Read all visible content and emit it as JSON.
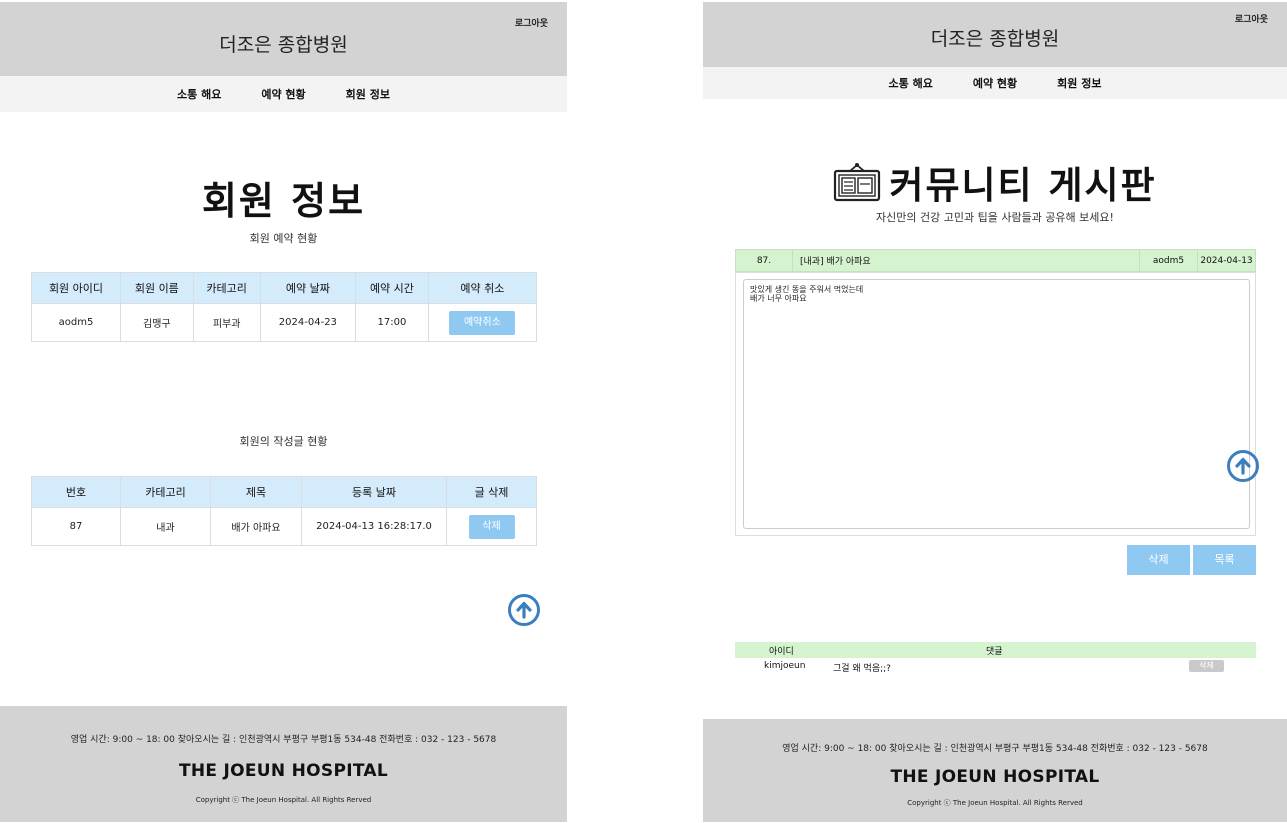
{
  "left": {
    "site_title": "더조은 종합병원",
    "logout": "로그아웃",
    "nav": [
      "소통 해요",
      "예약 현황",
      "회원 정보"
    ],
    "page_title": "회원 정보",
    "reservation_subtitle": "회원 예약 현황",
    "reservation_table": {
      "headers": [
        "회원 아이디",
        "회원 이름",
        "카테고리",
        "예약 날짜",
        "예약 시간",
        "예약 취소"
      ],
      "row": {
        "id": "aodm5",
        "name": "김맹구",
        "category": "피부과",
        "date": "2024-04-23",
        "time": "17:00",
        "cancel": "예약취소"
      }
    },
    "posts_subtitle": "회원의 작성글 현황",
    "posts_table": {
      "headers": [
        "번호",
        "카테고리",
        "제목",
        "등록 날짜",
        "글 삭제"
      ],
      "row": {
        "no": "87",
        "category": "내과",
        "title": "배가 아파요",
        "date": "2024-04-13 16:28:17.0",
        "delete": "삭제"
      }
    },
    "footer": {
      "info": "영업 시간: 9:00 ~ 18: 00     찾아오시는 길 : 인천광역시 부평구 부평1동 534-48     전화번호 : 032 - 123 - 5678",
      "brand": "THE JOEUN HOSPITAL",
      "copyright": "Copyright ⓒ The Joeun Hospital. All Rights Rerved"
    }
  },
  "right": {
    "site_title": "더조은 종합병원",
    "logout": "로그아웃",
    "nav": [
      "소통 해요",
      "예약 현황",
      "회원 정보"
    ],
    "page_title": "커뮤니티 게시판",
    "subtitle": "자신만의 건강 고민과 팁을 사람들과 공유해 보세요!",
    "post": {
      "no": "87.",
      "title": "[내과] 배가 아파요",
      "author": "aodm5",
      "date": "2024-04-13",
      "body": "맛있게 생긴 똥을 주워서 먹었는데\n배가 너무 아파요"
    },
    "buttons": {
      "delete": "삭제",
      "list": "목록"
    },
    "comments": {
      "headers": {
        "id": "아이디",
        "comment": "댓글"
      },
      "row": {
        "id": "kimjoeun",
        "text": "그걸 왜 먹음;;?",
        "delete": "삭제"
      }
    },
    "footer": {
      "info": "영업 시간: 9:00 ~ 18: 00     찾아오시는 길 : 인천광역시 부평구 부평1동 534-48     전화번호 : 032 - 123 - 5678",
      "brand": "THE JOEUN HOSPITAL",
      "copyright": "Copyright ⓒ The Joeun Hospital. All Rights Rerved"
    }
  },
  "colors": {
    "accent_blue": "#8fc9f2",
    "table_header_blue": "#d4ebfb",
    "green_header": "#d6f3d0",
    "header_gray": "#d3d3d3"
  },
  "icons": [
    "arrow-up-circle-icon",
    "bulletin-board-icon"
  ]
}
